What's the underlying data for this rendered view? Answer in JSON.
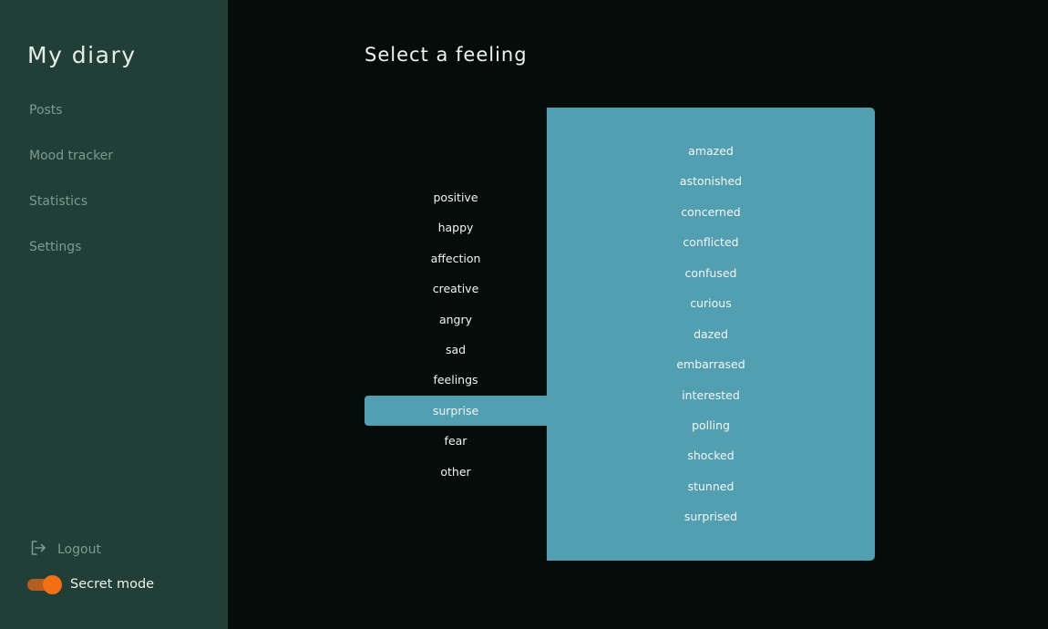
{
  "sidebar": {
    "app_title": "My diary",
    "nav": [
      {
        "label": "Posts"
      },
      {
        "label": "Mood tracker"
      },
      {
        "label": "Statistics"
      },
      {
        "label": "Settings"
      }
    ],
    "logout_label": "Logout",
    "secret_mode_label": "Secret mode",
    "secret_mode_on": true
  },
  "main": {
    "title": "Select a feeling",
    "categories": [
      {
        "label": "positive"
      },
      {
        "label": "happy"
      },
      {
        "label": "affection"
      },
      {
        "label": "creative"
      },
      {
        "label": "angry"
      },
      {
        "label": "sad"
      },
      {
        "label": "feelings"
      },
      {
        "label": "surprise"
      },
      {
        "label": "fear"
      },
      {
        "label": "other"
      }
    ],
    "selected_category": "surprise",
    "feelings": [
      {
        "label": "amazed"
      },
      {
        "label": "astonished"
      },
      {
        "label": "concerned"
      },
      {
        "label": "conflicted"
      },
      {
        "label": "confused"
      },
      {
        "label": "curious"
      },
      {
        "label": "dazed"
      },
      {
        "label": "embarrased"
      },
      {
        "label": "interested"
      },
      {
        "label": "polling"
      },
      {
        "label": "shocked"
      },
      {
        "label": "stunned"
      },
      {
        "label": "surprised"
      }
    ]
  },
  "colors": {
    "sidebar_bg": "#213f37",
    "page_bg": "#050d0a",
    "accent": "#519fb1",
    "toggle": "#f46e12"
  },
  "icons": {
    "logout": "logout-icon"
  }
}
